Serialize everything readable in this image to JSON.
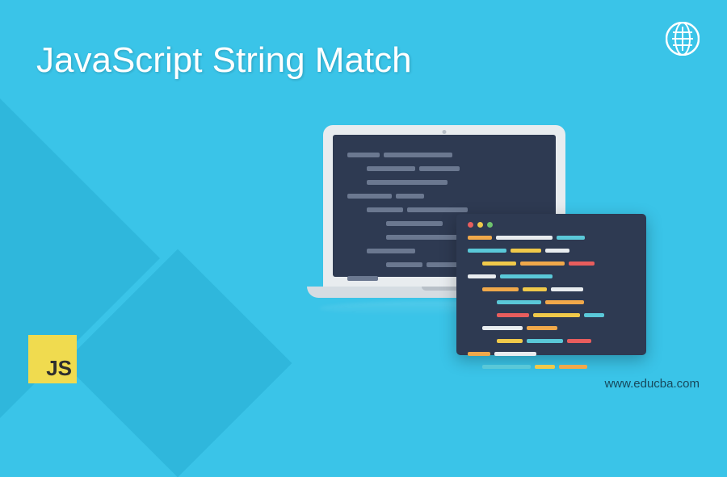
{
  "title": "JavaScript String Match",
  "logo": {
    "js_text": "JS"
  },
  "website_url": "www.educba.com",
  "colors": {
    "background": "#3ac4e8",
    "bg_shape": "#2fb7dc",
    "title_text": "#ffffff",
    "laptop_bezel": "#e8ecef",
    "laptop_base": "#d5dce2",
    "screen_dark": "#2e3a52",
    "js_yellow": "#f0db4f",
    "js_text": "#2e2e2e",
    "url_text": "#17495c",
    "dot_red": "#e85d5d",
    "dot_yellow": "#f0c94a",
    "dot_green": "#6ec36e",
    "code_gray": "#6b7890",
    "code_white": "#e8ecef",
    "code_orange": "#f0a84a",
    "code_yellow": "#f0c94a",
    "code_red": "#e85d5d",
    "code_cyan": "#5ac8d8"
  }
}
